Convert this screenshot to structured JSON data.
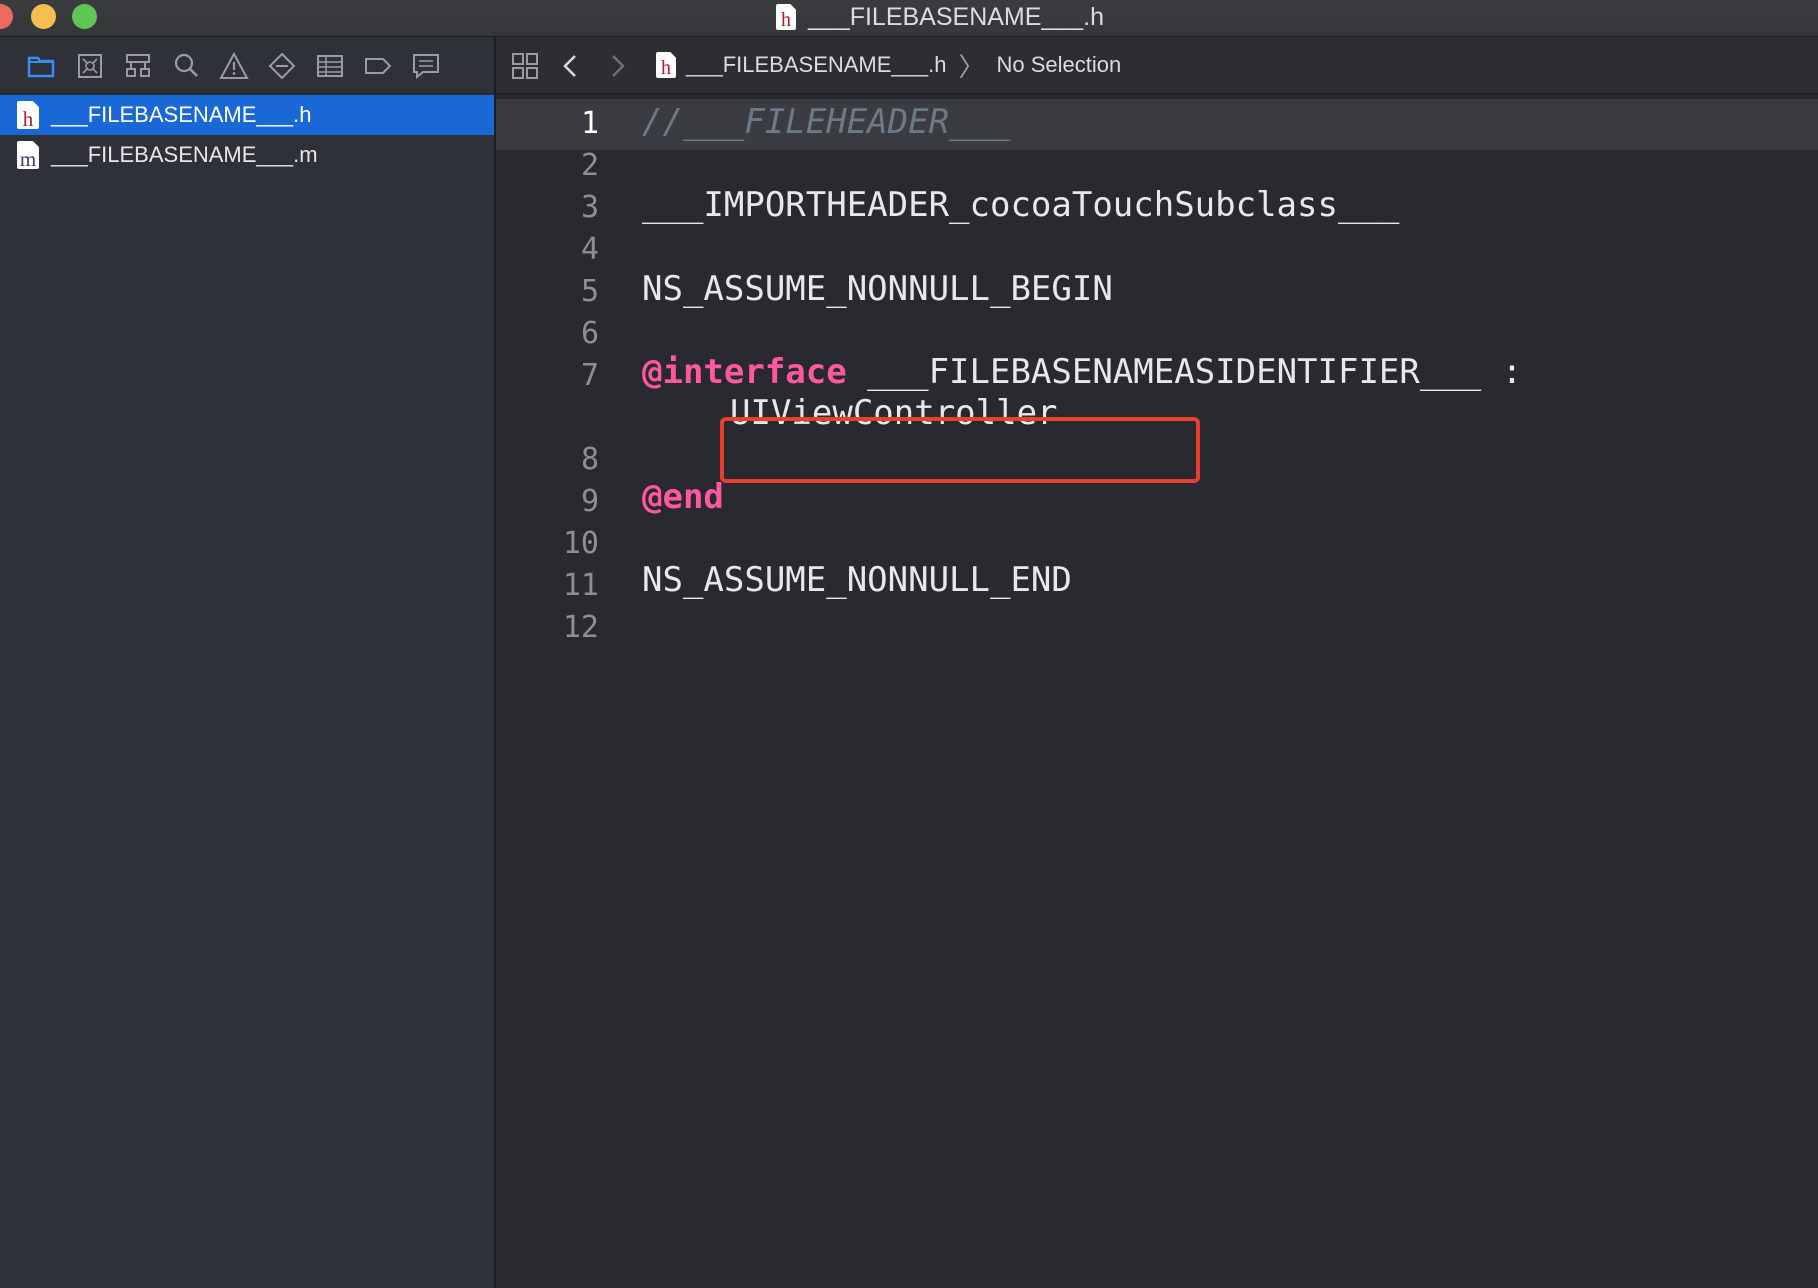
{
  "window": {
    "title": "___FILEBASENAME___.h",
    "title_icon_letter": "h"
  },
  "navigator": {
    "toolbar_icons": [
      "project-navigator-icon",
      "source-control-icon",
      "symbol-navigator-icon",
      "find-icon",
      "issue-navigator-icon",
      "test-navigator-icon",
      "debug-navigator-icon",
      "breakpoint-icon",
      "report-icon"
    ],
    "files": [
      {
        "name": "___FILEBASENAME___.h",
        "icon_letter": "h",
        "selected": true
      },
      {
        "name": "___FILEBASENAME___.m",
        "icon_letter": "m",
        "selected": false
      }
    ]
  },
  "jumpbar": {
    "file": "___FILEBASENAME___.h",
    "file_icon_letter": "h",
    "selection": "No Selection"
  },
  "editor": {
    "lines": [
      {
        "number": "1",
        "text": "//___FILEHEADER___"
      },
      {
        "number": "2",
        "text": ""
      },
      {
        "number": "3",
        "text": "___IMPORTHEADER_cocoaTouchSubclass___"
      },
      {
        "number": "4",
        "text": ""
      },
      {
        "number": "5",
        "text": "NS_ASSUME_NONNULL_BEGIN"
      },
      {
        "number": "6",
        "text": ""
      },
      {
        "number": "7",
        "keyword": "@interface",
        "rest": " ___FILEBASENAMEASIDENTIFIER___ :",
        "continuation": "UIViewController"
      },
      {
        "number": "8",
        "text": ""
      },
      {
        "number": "9",
        "keyword": "@end"
      },
      {
        "number": "10",
        "text": ""
      },
      {
        "number": "11",
        "text": "NS_ASSUME_NONNULL_END"
      },
      {
        "number": "12",
        "text": ""
      }
    ],
    "colors": {
      "keyword": "#ff58a0",
      "comment": "#6c7986",
      "text": "#e8e8ea",
      "highlight_border": "#e8402a",
      "selection": "#1a67d6"
    }
  }
}
